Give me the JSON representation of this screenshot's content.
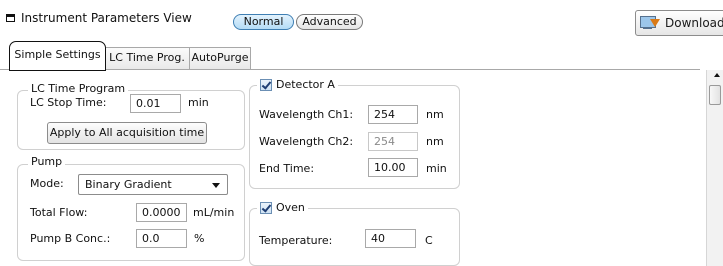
{
  "view": {
    "title": "Instrument Parameters View",
    "modes": [
      "Normal",
      "Advanced"
    ],
    "active_mode": "Normal",
    "download_label": "Download"
  },
  "tabs": [
    {
      "label": "Simple Settings",
      "active": true
    },
    {
      "label": "LC Time Prog.",
      "active": false
    },
    {
      "label": "AutoPurge",
      "active": false
    }
  ],
  "lc_time_program": {
    "legend": "LC Time Program",
    "stop_time_label": "LC Stop Time:",
    "stop_time_value": "0.01",
    "stop_time_unit": "min",
    "apply_button": "Apply to All acquisition time"
  },
  "pump": {
    "legend": "Pump",
    "mode_label": "Mode:",
    "mode_value": "Binary Gradient",
    "total_flow_label": "Total Flow:",
    "total_flow_value": "0.0000",
    "total_flow_unit": "mL/min",
    "pump_b_label": "Pump B Conc.:",
    "pump_b_value": "0.0",
    "pump_b_unit": "%"
  },
  "detector": {
    "legend": "Detector A",
    "checked": true,
    "wl1_label": "Wavelength Ch1:",
    "wl1_value": "254",
    "wl1_unit": "nm",
    "wl2_label": "Wavelength Ch2:",
    "wl2_value": "254",
    "wl2_unit": "nm",
    "end_time_label": "End Time:",
    "end_time_value": "10.00",
    "end_time_unit": "min"
  },
  "oven": {
    "legend": "Oven",
    "checked": true,
    "temperature_label": "Temperature:",
    "temperature_value": "40",
    "temperature_unit": "C"
  }
}
